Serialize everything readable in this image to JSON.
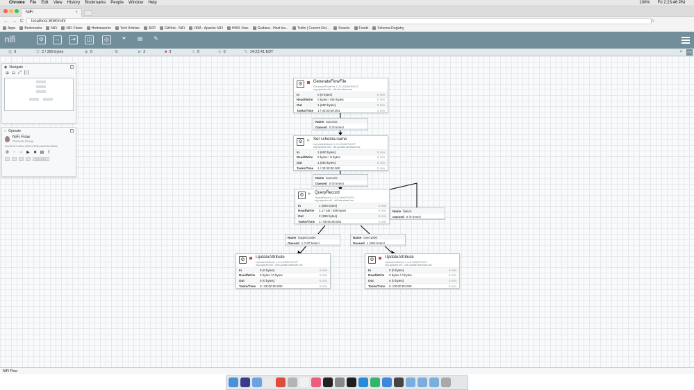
{
  "menubar": {
    "apple": "",
    "app": "Chrome",
    "items": [
      "File",
      "Edit",
      "View",
      "History",
      "Bookmarks",
      "People",
      "Window",
      "Help"
    ],
    "battery": "100%",
    "clock": "Fri 2:23:46 PM"
  },
  "tab": {
    "title": "NiFi",
    "close": "×"
  },
  "address": {
    "back": "←",
    "forward": "→",
    "reload": "C",
    "url": "localhost:8080/nifi/",
    "star": "☆"
  },
  "bookmarks": [
    "Apps",
    "Bookmarks",
    "NiFi",
    "NiFi Flows",
    "Hortonworks",
    "Tech Articles",
    "ADP",
    "GitHub - NiFi",
    "JIRA - Apache NiFi",
    "HWX Jiras",
    "Grafana - Host lev...",
    "Trello | Current Rel...",
    "Snacks",
    "Foods",
    "Schema Registry"
  ],
  "status": {
    "threads": "0",
    "queued": "2 / 399 bytes",
    "transmitting": "0",
    "not_transmitting": "0",
    "running": "2",
    "stopped": "3",
    "invalid": "0",
    "disabled": "0",
    "refresh": "14:23:41 EDT"
  },
  "navigate": {
    "title": "Navigate",
    "zoom_in": "⊕",
    "zoom_out": "⊖",
    "fit": "⤢",
    "actual": "[↕]"
  },
  "operate": {
    "title": "Operate",
    "group_name": "NiFi Flow",
    "group_type": "Process Group",
    "group_id": "69c51767-015c-1000-3125-b0a763c7089b",
    "delete_label": "DELETE"
  },
  "processors": [
    {
      "name": "GenerateFlowFile",
      "type": "GenerateFlowFile 1.3.0-SNAPSHOT",
      "bundle": "org.apache.nifi - nifi-standard-nar",
      "state": "stopped",
      "rows": [
        {
          "k": "In",
          "v": "0 (0 bytes)",
          "t": "5 min"
        },
        {
          "k": "Read/Write",
          "v": "0 bytes / 600 bytes",
          "t": "5 min"
        },
        {
          "k": "Out",
          "v": "1 (600 bytes)",
          "t": "5 min"
        },
        {
          "k": "Tasks/Time",
          "v": "1 / 00:00:00.001",
          "t": "5 min"
        }
      ]
    },
    {
      "name": "Set schema.name",
      "type": "UpdateAttribute 1.3.0-SNAPSHOT",
      "bundle": "org.apache.nifi - nifi-update-attribute-nar",
      "state": "running",
      "rows": [
        {
          "k": "In",
          "v": "1 (600 bytes)",
          "t": "5 min"
        },
        {
          "k": "Read/Write",
          "v": "0 bytes / 0 bytes",
          "t": "5 min"
        },
        {
          "k": "Out",
          "v": "1 (600 bytes)",
          "t": "5 min"
        },
        {
          "k": "Tasks/Time",
          "v": "1 / 00:00:00.000",
          "t": "5 min"
        }
      ]
    },
    {
      "name": "QueryRecord",
      "type": "QueryRecord 1.3.0-SNAPSHOT",
      "bundle": "org.apache.nifi - nifi-standard-nar",
      "state": "running",
      "rows": [
        {
          "k": "In",
          "v": "1 (600 bytes)",
          "t": "5 min"
        },
        {
          "k": "Read/Write",
          "v": "1.17 KB / 399 bytes",
          "t": "5 min"
        },
        {
          "k": "Out",
          "v": "2 (399 bytes)",
          "t": "5 min"
        },
        {
          "k": "Tasks/Time",
          "v": "1 / 00:00:00.001",
          "t": "5 min"
        }
      ]
    },
    {
      "name": "UpdateAttribute",
      "type": "UpdateAttribute 1.3.0-SNAPSHOT",
      "bundle": "org.apache.nifi - nifi-update-attribute-nar",
      "state": "stopped",
      "rows": [
        {
          "k": "In",
          "v": "0 (0 bytes)",
          "t": "5 min"
        },
        {
          "k": "Read/Write",
          "v": "0 bytes / 0 bytes",
          "t": "5 min"
        },
        {
          "k": "Out",
          "v": "0 (0 bytes)",
          "t": "5 min"
        },
        {
          "k": "Tasks/Time",
          "v": "0 / 00:00:00.000",
          "t": "5 min"
        }
      ]
    },
    {
      "name": "UpdateAttribute",
      "type": "UpdateAttribute 1.3.0-SNAPSHOT",
      "bundle": "org.apache.nifi - nifi-update-attribute-nar",
      "state": "stopped",
      "rows": [
        {
          "k": "In",
          "v": "0 (0 bytes)",
          "t": "5 min"
        },
        {
          "k": "Read/Write",
          "v": "0 bytes / 0 bytes",
          "t": "5 min"
        },
        {
          "k": "Out",
          "v": "0 (0 bytes)",
          "t": "5 min"
        },
        {
          "k": "Tasks/Time",
          "v": "0 / 00:00:00.000",
          "t": "5 min"
        }
      ]
    }
  ],
  "connections": [
    {
      "name_label": "Name",
      "name": "success",
      "queued_label": "Queued",
      "queued": "0 (0 bytes)"
    },
    {
      "name_label": "Name",
      "name": "success",
      "queued_label": "Queued",
      "queued": "0 (0 bytes)"
    },
    {
      "name_label": "Name",
      "name": "failure",
      "queued_label": "Queued",
      "queued": "0 (0 bytes)"
    },
    {
      "name_label": "Name",
      "name": "largest.order",
      "queued_label": "Queued",
      "queued": "1 (137 bytes)"
    },
    {
      "name_label": "Name",
      "name": "over.1000",
      "queued_label": "Queued",
      "queued": "1 (262 bytes)"
    }
  ],
  "footer": {
    "breadcrumb": "NiFi Flow"
  },
  "logo": "nifi"
}
